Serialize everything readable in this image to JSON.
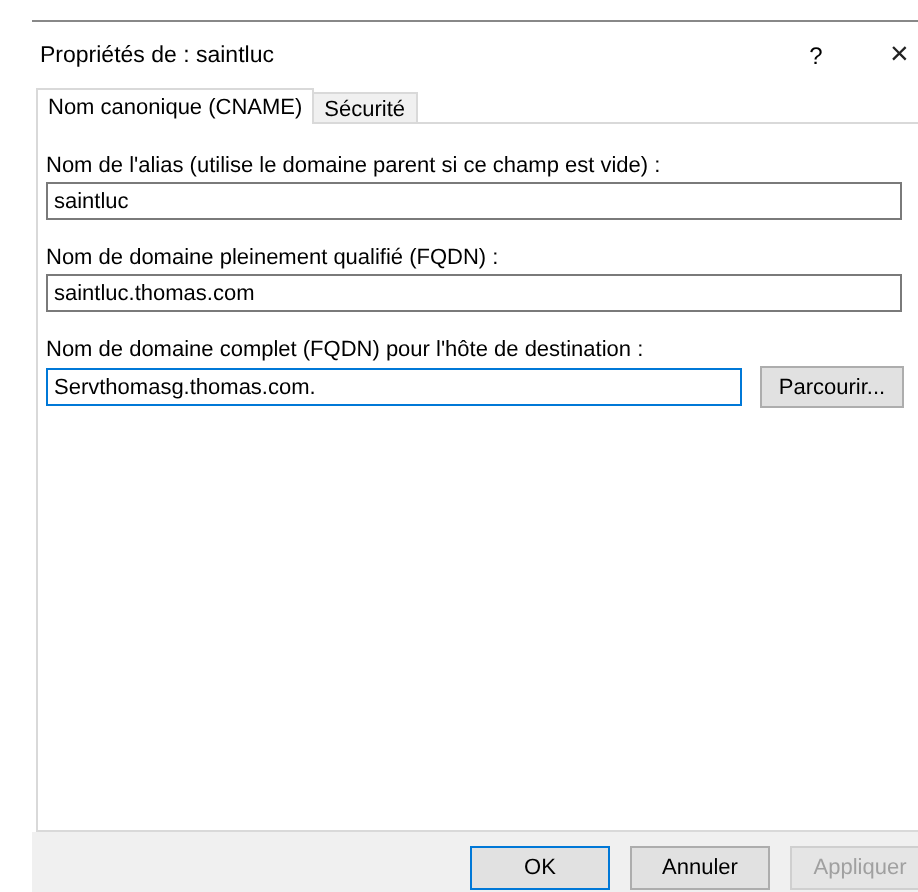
{
  "window": {
    "title": "Propriétés de : saintluc",
    "help": "?",
    "close": "×"
  },
  "tabs": [
    {
      "label": "Nom canonique (CNAME)",
      "selected": true
    },
    {
      "label": "Sécurité",
      "selected": false
    }
  ],
  "fields": [
    {
      "label": "Nom de l'alias (utilise le domaine parent si ce champ est vide) :",
      "value": "saintluc",
      "focused": false
    },
    {
      "label": "Nom de domaine pleinement qualifié (FQDN) :",
      "value": "saintluc.thomas.com",
      "focused": false
    },
    {
      "label": "Nom de domaine complet (FQDN) pour l'hôte de destination :",
      "value": "Servthomasg.thomas.com.",
      "focused": true,
      "button": "Parcourir..."
    }
  ],
  "buttons": [
    {
      "label": "OK",
      "default": true,
      "disabled": false
    },
    {
      "label": "Annuler",
      "default": false,
      "disabled": false
    },
    {
      "label": "Appliquer",
      "default": false,
      "disabled": true
    }
  ]
}
